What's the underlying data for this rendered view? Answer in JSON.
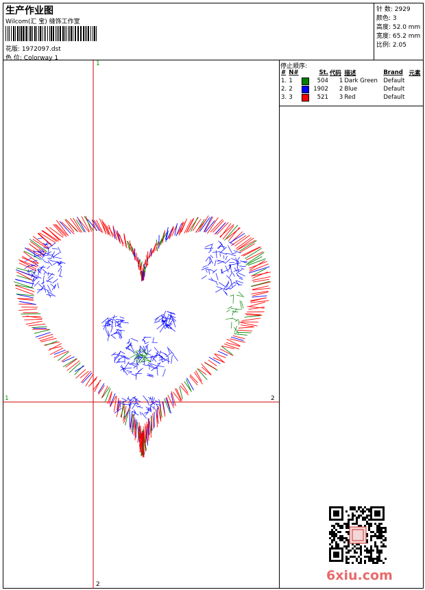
{
  "header": {
    "title": "生产作业图",
    "company": "Wilcom(汇 宝) 缝饰工作室",
    "file_label": "花版:",
    "file_value": "1972097.dst",
    "colorway_label": "色 位:",
    "colorway_value": "Colorway 1"
  },
  "stats": {
    "stitches": "针 数: 2929",
    "colors": "颜色: 3",
    "height": "高度: 52.0 mm",
    "width": "宽度: 65.2 mm",
    "scale": "比例: 2.05"
  },
  "stop_sequence": {
    "title": "停止顺序:",
    "headers": [
      "#",
      "N#",
      "St.",
      "代码",
      "描述",
      "Brand",
      "元素"
    ],
    "rows": [
      {
        "idx": "1.",
        "n": "1",
        "color": "#008000",
        "st": "504",
        "code": "1",
        "desc": "Dark Green",
        "brand": "Default"
      },
      {
        "idx": "2.",
        "n": "2",
        "color": "#0000ff",
        "st": "1902",
        "code": "2",
        "desc": "Blue",
        "brand": "Default"
      },
      {
        "idx": "3.",
        "n": "3",
        "color": "#ff0000",
        "st": "521",
        "code": "3",
        "desc": "Red",
        "brand": "Default"
      }
    ]
  },
  "axes": {
    "top_label": "1",
    "left_label": "1",
    "right_label": "2",
    "bottom_label": "2"
  },
  "watermark": "6xiu.com",
  "colors": {
    "axis": "#cc0000",
    "green": "#008000",
    "blue": "#0000ff",
    "red": "#ff0000"
  }
}
